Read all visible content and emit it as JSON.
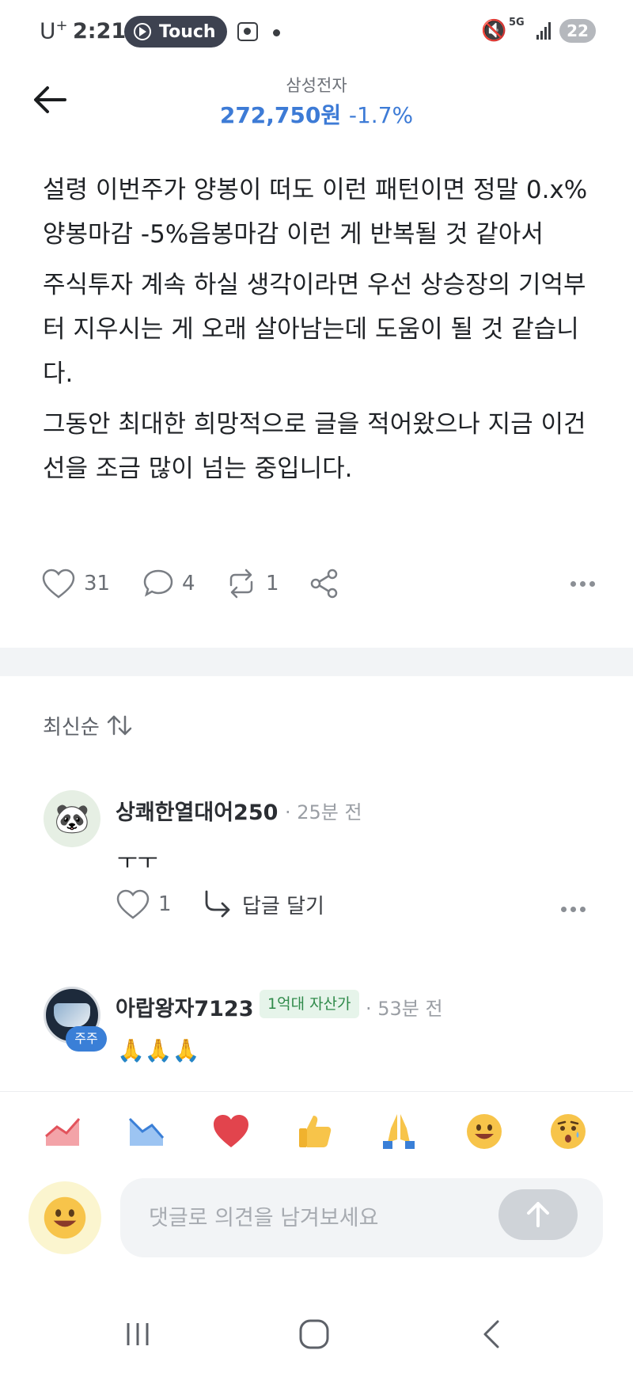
{
  "status_bar": {
    "carrier": "U",
    "carrier_sup": "+",
    "time": "2:21",
    "touch_label": "Touch",
    "network": "5G",
    "battery": "22"
  },
  "header": {
    "stock_name": "삼성전자",
    "price": "272,750원",
    "change": "-1.7%"
  },
  "post": {
    "paragraphs": [
      "설령 이번주가 양봉이 떠도 이런 패턴이면 정말 0.x% 양봉마감 -5%음봉마감 이런 게 반복될 것 같아서",
      "주식투자 계속 하실 생각이라면 우선 상승장의 기억부터 지우시는 게 오래 살아남는데 도움이 될 것 같습니다.",
      "그동안 최대한 희망적으로 글을 적어왔으나 지금 이건 선을 조금 많이 넘는 중입니다."
    ],
    "likes": "31",
    "comments": "4",
    "reposts": "1"
  },
  "sort": {
    "label": "최신순"
  },
  "comments": [
    {
      "author": "상쾌한열대어250",
      "time": "· 25분 전",
      "text": "ㅜㅜ",
      "likes": "1",
      "reply_label": "답글 달기"
    },
    {
      "author": "아랍왕자7123",
      "holder_badge": "주주",
      "tag": "1억대 자산가",
      "time": "· 53분 전",
      "text": "🙏🙏🙏"
    }
  ],
  "reactions": [
    "rise-chart",
    "fall-chart",
    "heart",
    "thumbs-up",
    "pray",
    "smile",
    "surprised"
  ],
  "input": {
    "placeholder": "댓글로 의견을 남겨보세요"
  },
  "colors": {
    "price_blue": "#3d7bd6",
    "tag_green": "#2f8a4a",
    "badge_blue": "#3a7fd7"
  }
}
